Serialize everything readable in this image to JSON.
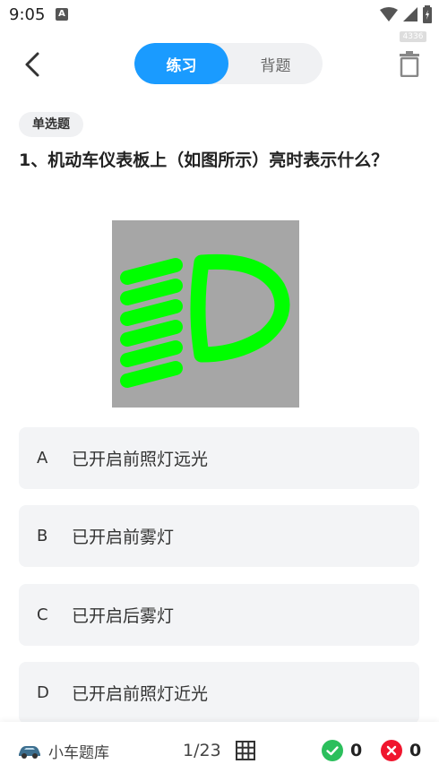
{
  "status_bar": {
    "time": "9:05",
    "notification_icon": "A",
    "watermark": "4336"
  },
  "header": {
    "tabs": [
      {
        "label": "练习",
        "active": true
      },
      {
        "label": "背题",
        "active": false
      }
    ]
  },
  "question": {
    "type_badge": "单选题",
    "text": "1、机动车仪表板上（如图所示）亮时表示什么？",
    "image_icon": "high-beam-indicator-icon"
  },
  "options": [
    {
      "letter": "A",
      "text": "已开启前照灯远光"
    },
    {
      "letter": "B",
      "text": "已开启前雾灯"
    },
    {
      "letter": "C",
      "text": "已开启后雾灯"
    },
    {
      "letter": "D",
      "text": "已开启前照灯近光"
    }
  ],
  "bottom_bar": {
    "bank_label": "小车题库",
    "progress": "1/23",
    "correct_count": "0",
    "wrong_count": "0"
  },
  "colors": {
    "accent": "#1a9bff",
    "correct": "#2bbf5c",
    "wrong": "#f0162e",
    "indicator_green": "#00ff00",
    "indicator_bg": "#a6a6a6"
  }
}
